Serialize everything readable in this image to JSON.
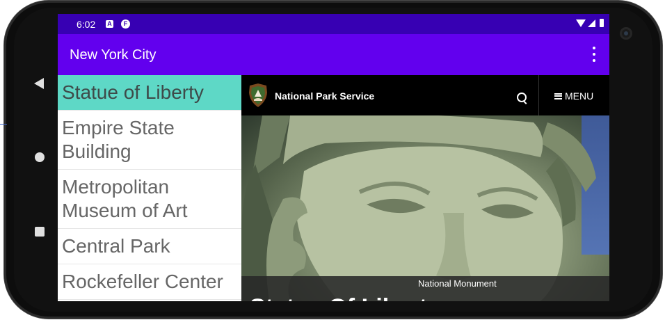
{
  "status_bar": {
    "time": "6:02",
    "icons": [
      "a-notification-icon",
      "f-notification-icon",
      "wifi-icon",
      "cell-signal-icon",
      "battery-icon"
    ],
    "notification_a": "A",
    "notification_f": "F"
  },
  "app_bar": {
    "title": "New York City",
    "overflow_icon": "more-vert-icon",
    "color": "#6200ee",
    "status_color": "#3700b3"
  },
  "list": {
    "selected_color": "#5ed8c6",
    "items": [
      {
        "label": "Statue of Liberty",
        "selected": true
      },
      {
        "label": "Empire State Building",
        "selected": false
      },
      {
        "label": "Metropolitan Museum of Art",
        "selected": false
      },
      {
        "label": "Central Park",
        "selected": false
      },
      {
        "label": "Rockefeller Center",
        "selected": false
      }
    ]
  },
  "web": {
    "site_name": "National Park Service",
    "search_icon": "search-icon",
    "menu_label": "MENU",
    "hero_title": "Statue Of Liberty",
    "hero_subtitle": "National Monument"
  },
  "device": {
    "nav_icons": [
      "back-icon",
      "home-icon",
      "recents-icon"
    ]
  }
}
